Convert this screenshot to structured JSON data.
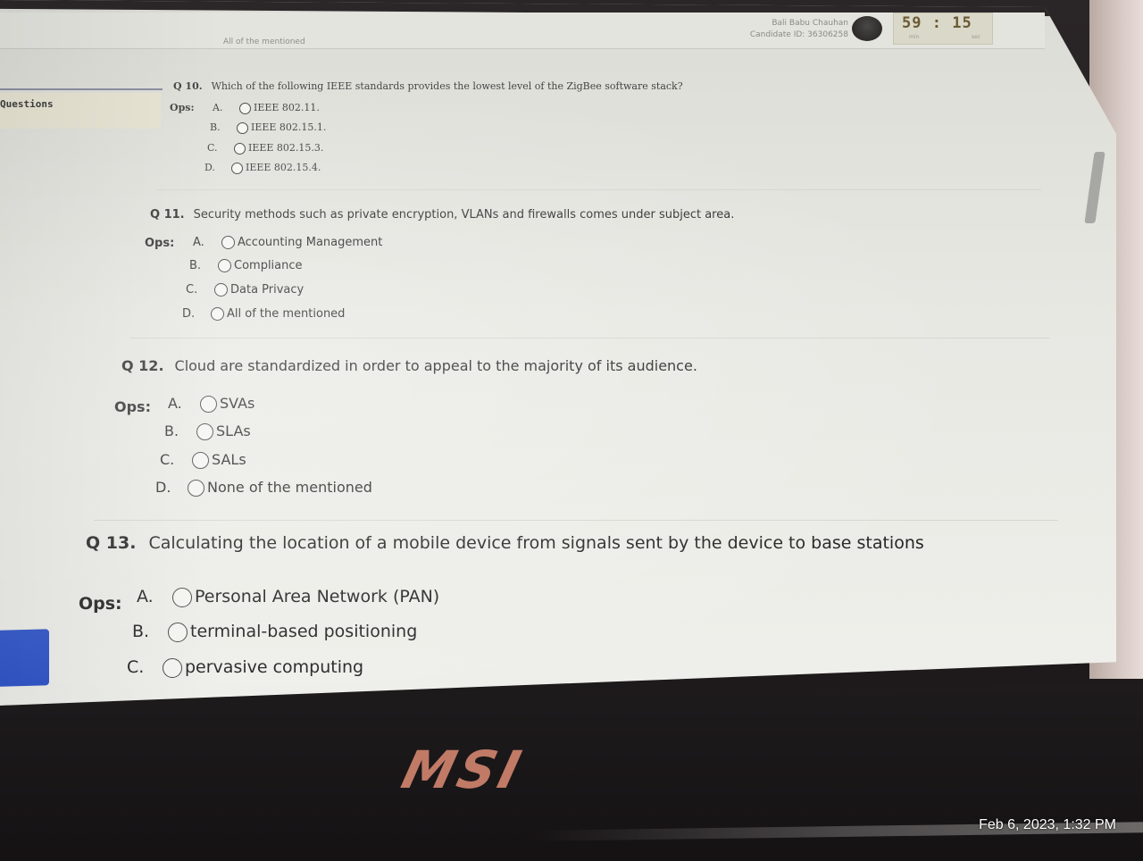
{
  "header": {
    "candidate_name": "Bali Babu Chauhan",
    "candidate_id": "Candidate ID: 36306258",
    "timer": {
      "minutes": "59",
      "separator": ":",
      "seconds": "15",
      "minutes_unit": "min",
      "seconds_unit": "sec"
    }
  },
  "previous_option_text": "All of the mentioned",
  "sidebar": {
    "questions_label": "Questions"
  },
  "questions": [
    {
      "number": "Q 10.",
      "text": "Which of the following IEEE standards provides the lowest level of the ZigBee software stack?",
      "ops_label": "Ops:",
      "options": [
        {
          "letter": "A.",
          "text": "IEEE 802.11."
        },
        {
          "letter": "B.",
          "text": "IEEE 802.15.1."
        },
        {
          "letter": "C.",
          "text": "IEEE 802.15.3."
        },
        {
          "letter": "D.",
          "text": "IEEE 802.15.4."
        }
      ]
    },
    {
      "number": "Q 11.",
      "text": "Security methods such as private encryption, VLANs and firewalls comes under subject area.",
      "ops_label": "Ops:",
      "options": [
        {
          "letter": "A.",
          "text": "Accounting Management"
        },
        {
          "letter": "B.",
          "text": "Compliance"
        },
        {
          "letter": "C.",
          "text": "Data Privacy"
        },
        {
          "letter": "D.",
          "text": "All of the mentioned"
        }
      ]
    },
    {
      "number": "Q 12.",
      "text": "Cloud are standardized in order to appeal to the majority of its audience.",
      "ops_label": "Ops:",
      "options": [
        {
          "letter": "A.",
          "text": "SVAs"
        },
        {
          "letter": "B.",
          "text": "SLAs"
        },
        {
          "letter": "C.",
          "text": "SALs"
        },
        {
          "letter": "D.",
          "text": "None of the mentioned"
        }
      ]
    },
    {
      "number": "Q 13.",
      "text": "Calculating the location of a mobile device from signals sent by the device to base stations",
      "ops_label": "Ops:",
      "options": [
        {
          "letter": "A.",
          "text": "Personal Area Network (PAN)"
        },
        {
          "letter": "B.",
          "text": "terminal-based positioning"
        },
        {
          "letter": "C.",
          "text": "pervasive computing"
        }
      ]
    }
  ],
  "laptop_brand": "MSI",
  "photo_timestamp": "Feb 6, 2023, 1:32 PM"
}
